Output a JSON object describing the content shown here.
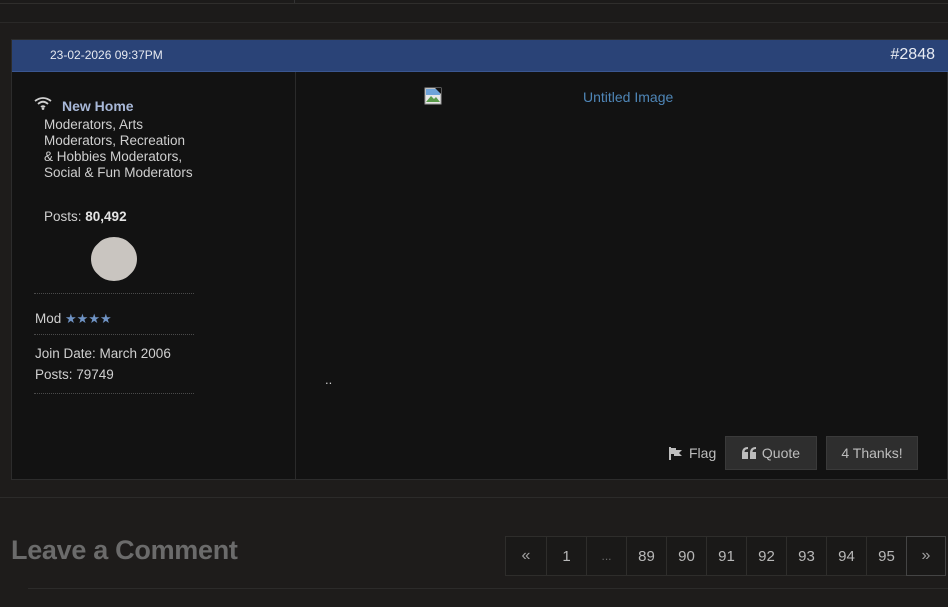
{
  "post": {
    "date": "23-02-2026 09:37PM",
    "number": "#2848",
    "user": {
      "name": "New Home",
      "groups": "Moderators, Arts Moderators, Recreation & Hobbies Moderators, Social & Fun Moderators",
      "posts_label": "Posts:",
      "posts_value": "80,492",
      "rank_label": "Mod",
      "rank_stars": "★★★★",
      "join_date": "Join Date: March 2006",
      "posts_line": "Posts: 79749"
    },
    "content": {
      "image_alt": "Untitled Image",
      "text": ".."
    },
    "actions": {
      "flag_label": "Flag",
      "quote_label": "Quote",
      "thanks_label": "4 Thanks!"
    }
  },
  "comments": {
    "heading": "Leave a Comment"
  },
  "pagination": {
    "prev": "«",
    "pages": [
      "1",
      "...",
      "89",
      "90",
      "91",
      "92",
      "93",
      "94",
      "95"
    ],
    "next": "»"
  },
  "colors": {
    "header_bg": "#2a4377",
    "username": "#a8b8d8",
    "link": "#4f86b7",
    "stars": "#6f93c4"
  },
  "icons": [
    "wifi-icon",
    "broken-image-icon",
    "flag-icon",
    "quote-icon"
  ]
}
